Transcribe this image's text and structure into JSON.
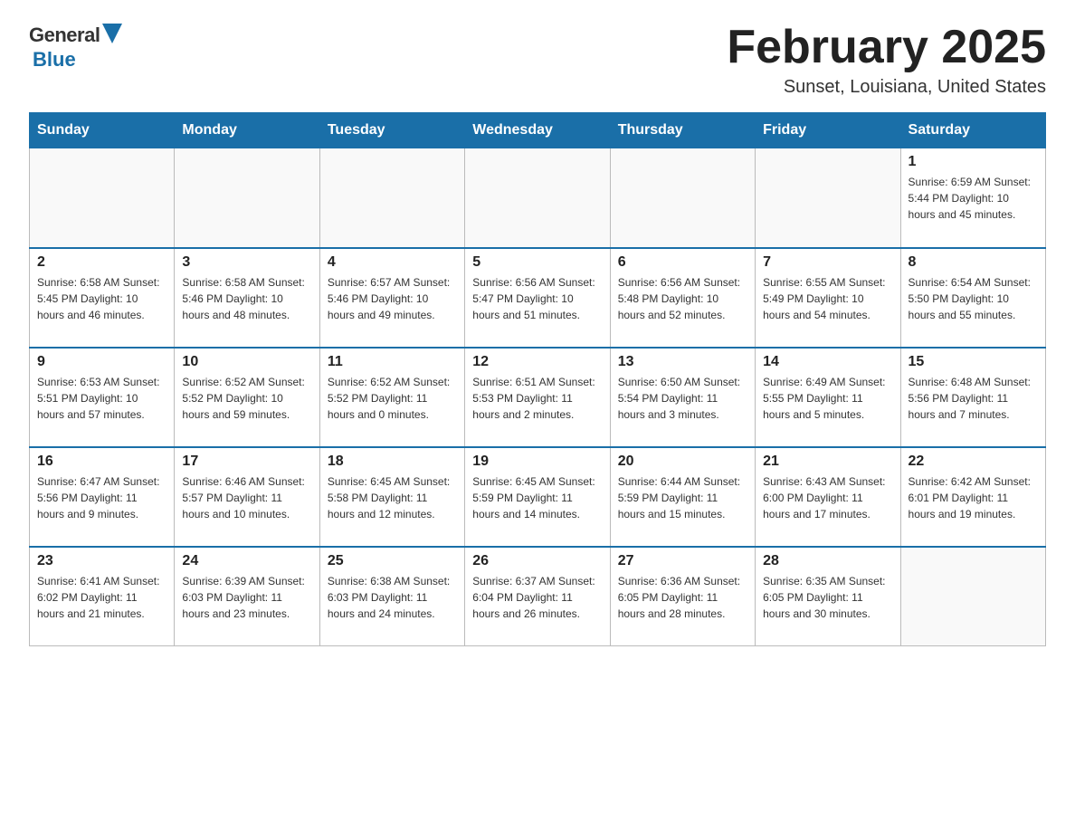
{
  "header": {
    "logo": {
      "general": "General",
      "blue": "Blue"
    },
    "title": "February 2025",
    "location": "Sunset, Louisiana, United States"
  },
  "days_of_week": [
    "Sunday",
    "Monday",
    "Tuesday",
    "Wednesday",
    "Thursday",
    "Friday",
    "Saturday"
  ],
  "weeks": [
    {
      "cells": [
        {
          "day": "",
          "info": ""
        },
        {
          "day": "",
          "info": ""
        },
        {
          "day": "",
          "info": ""
        },
        {
          "day": "",
          "info": ""
        },
        {
          "day": "",
          "info": ""
        },
        {
          "day": "",
          "info": ""
        },
        {
          "day": "1",
          "info": "Sunrise: 6:59 AM\nSunset: 5:44 PM\nDaylight: 10 hours\nand 45 minutes."
        }
      ]
    },
    {
      "cells": [
        {
          "day": "2",
          "info": "Sunrise: 6:58 AM\nSunset: 5:45 PM\nDaylight: 10 hours\nand 46 minutes."
        },
        {
          "day": "3",
          "info": "Sunrise: 6:58 AM\nSunset: 5:46 PM\nDaylight: 10 hours\nand 48 minutes."
        },
        {
          "day": "4",
          "info": "Sunrise: 6:57 AM\nSunset: 5:46 PM\nDaylight: 10 hours\nand 49 minutes."
        },
        {
          "day": "5",
          "info": "Sunrise: 6:56 AM\nSunset: 5:47 PM\nDaylight: 10 hours\nand 51 minutes."
        },
        {
          "day": "6",
          "info": "Sunrise: 6:56 AM\nSunset: 5:48 PM\nDaylight: 10 hours\nand 52 minutes."
        },
        {
          "day": "7",
          "info": "Sunrise: 6:55 AM\nSunset: 5:49 PM\nDaylight: 10 hours\nand 54 minutes."
        },
        {
          "day": "8",
          "info": "Sunrise: 6:54 AM\nSunset: 5:50 PM\nDaylight: 10 hours\nand 55 minutes."
        }
      ]
    },
    {
      "cells": [
        {
          "day": "9",
          "info": "Sunrise: 6:53 AM\nSunset: 5:51 PM\nDaylight: 10 hours\nand 57 minutes."
        },
        {
          "day": "10",
          "info": "Sunrise: 6:52 AM\nSunset: 5:52 PM\nDaylight: 10 hours\nand 59 minutes."
        },
        {
          "day": "11",
          "info": "Sunrise: 6:52 AM\nSunset: 5:52 PM\nDaylight: 11 hours\nand 0 minutes."
        },
        {
          "day": "12",
          "info": "Sunrise: 6:51 AM\nSunset: 5:53 PM\nDaylight: 11 hours\nand 2 minutes."
        },
        {
          "day": "13",
          "info": "Sunrise: 6:50 AM\nSunset: 5:54 PM\nDaylight: 11 hours\nand 3 minutes."
        },
        {
          "day": "14",
          "info": "Sunrise: 6:49 AM\nSunset: 5:55 PM\nDaylight: 11 hours\nand 5 minutes."
        },
        {
          "day": "15",
          "info": "Sunrise: 6:48 AM\nSunset: 5:56 PM\nDaylight: 11 hours\nand 7 minutes."
        }
      ]
    },
    {
      "cells": [
        {
          "day": "16",
          "info": "Sunrise: 6:47 AM\nSunset: 5:56 PM\nDaylight: 11 hours\nand 9 minutes."
        },
        {
          "day": "17",
          "info": "Sunrise: 6:46 AM\nSunset: 5:57 PM\nDaylight: 11 hours\nand 10 minutes."
        },
        {
          "day": "18",
          "info": "Sunrise: 6:45 AM\nSunset: 5:58 PM\nDaylight: 11 hours\nand 12 minutes."
        },
        {
          "day": "19",
          "info": "Sunrise: 6:45 AM\nSunset: 5:59 PM\nDaylight: 11 hours\nand 14 minutes."
        },
        {
          "day": "20",
          "info": "Sunrise: 6:44 AM\nSunset: 5:59 PM\nDaylight: 11 hours\nand 15 minutes."
        },
        {
          "day": "21",
          "info": "Sunrise: 6:43 AM\nSunset: 6:00 PM\nDaylight: 11 hours\nand 17 minutes."
        },
        {
          "day": "22",
          "info": "Sunrise: 6:42 AM\nSunset: 6:01 PM\nDaylight: 11 hours\nand 19 minutes."
        }
      ]
    },
    {
      "cells": [
        {
          "day": "23",
          "info": "Sunrise: 6:41 AM\nSunset: 6:02 PM\nDaylight: 11 hours\nand 21 minutes."
        },
        {
          "day": "24",
          "info": "Sunrise: 6:39 AM\nSunset: 6:03 PM\nDaylight: 11 hours\nand 23 minutes."
        },
        {
          "day": "25",
          "info": "Sunrise: 6:38 AM\nSunset: 6:03 PM\nDaylight: 11 hours\nand 24 minutes."
        },
        {
          "day": "26",
          "info": "Sunrise: 6:37 AM\nSunset: 6:04 PM\nDaylight: 11 hours\nand 26 minutes."
        },
        {
          "day": "27",
          "info": "Sunrise: 6:36 AM\nSunset: 6:05 PM\nDaylight: 11 hours\nand 28 minutes."
        },
        {
          "day": "28",
          "info": "Sunrise: 6:35 AM\nSunset: 6:05 PM\nDaylight: 11 hours\nand 30 minutes."
        },
        {
          "day": "",
          "info": ""
        }
      ]
    }
  ]
}
